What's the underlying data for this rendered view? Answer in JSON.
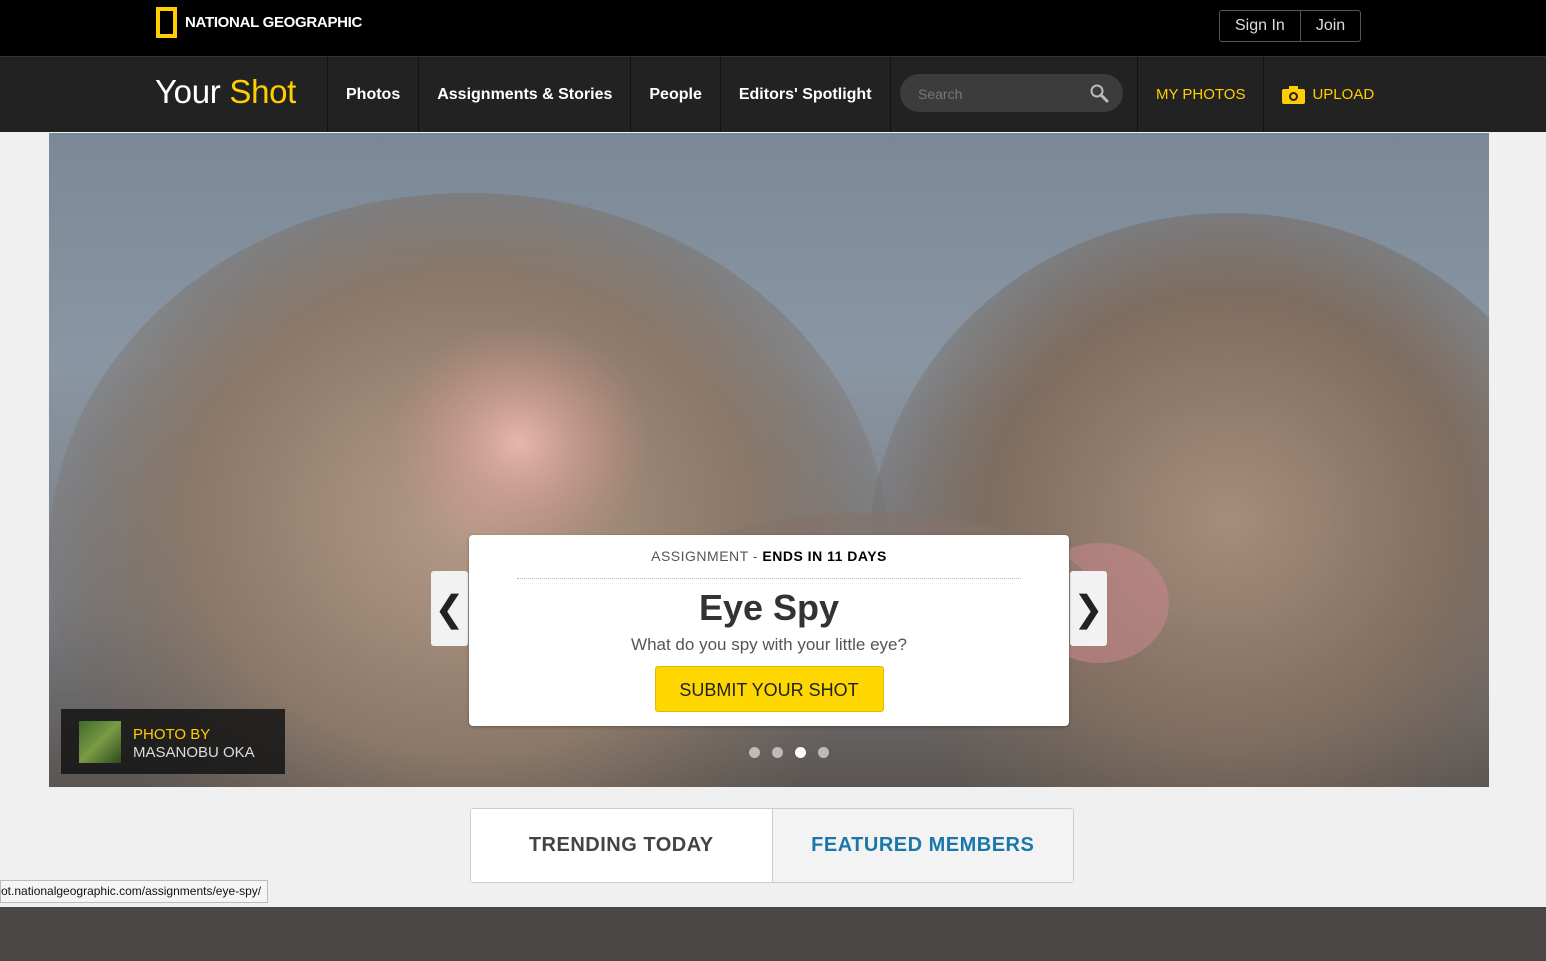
{
  "topbar": {
    "logo_text": "NATIONAL GEOGRAPHIC",
    "sign_in": "Sign In",
    "join": "Join"
  },
  "brand": {
    "part1": "Your",
    "part2": "Shot"
  },
  "nav": {
    "items": [
      "Photos",
      "Assignments & Stories",
      "People",
      "Editors' Spotlight"
    ],
    "search_placeholder": "Search",
    "my_photos": "MY PHOTOS",
    "upload": "UPLOAD"
  },
  "hero": {
    "card": {
      "label": "ASSIGNMENT -",
      "ends": "ENDS IN 11 DAYS",
      "title": "Eye Spy",
      "subtitle": "What do you spy with your little eye?",
      "button": "SUBMIT YOUR SHOT"
    },
    "prev_arrow": "❮",
    "next_arrow": "❯",
    "dots_count": 4,
    "active_dot": 3,
    "credit": {
      "by": "PHOTO BY",
      "name": "MASANOBU OKA"
    }
  },
  "tabs": [
    "TRENDING TODAY",
    "FEATURED MEMBERS"
  ],
  "status_url": "ot.nationalgeographic.com/assignments/eye-spy/",
  "colors": {
    "accent": "#ffce00",
    "link_blue": "#1a78a8",
    "nav_bg": "#222222"
  }
}
